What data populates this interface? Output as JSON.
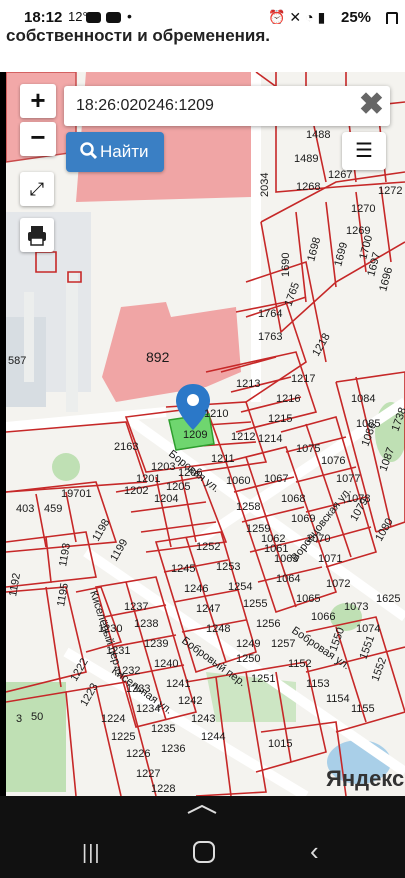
{
  "status_bar": {
    "time": "18:12",
    "temperature": "12°",
    "battery": "25%"
  },
  "page": {
    "heading": "собственности и обременения."
  },
  "map": {
    "search_value": "18:26:020246:1209",
    "find_label": "Найти",
    "zoom_in_label": "+",
    "zoom_out_label": "−",
    "clear_label": "✖",
    "attribution": "Яндекс",
    "selected_parcel": "1209",
    "street_labels": [
      "Боровая ул.",
      "Бобровый пер.",
      "Киселёвый пер.",
      "Кисельная ул.",
      "Бобровая ул.",
      "Воронцовская ул."
    ],
    "parcels": [
      "1488",
      "1489",
      "1267",
      "1268",
      "1269",
      "1270",
      "1272",
      "1700",
      "1699",
      "1698",
      "1697",
      "1696",
      "1690",
      "1765",
      "1764",
      "1763",
      "1218",
      "1217",
      "1216",
      "1215",
      "1214",
      "1213",
      "1210",
      "1212",
      "1211",
      "2163",
      "1209",
      "1201",
      "1202",
      "1203",
      "1204",
      "1205",
      "1206",
      "1075",
      "1076",
      "1077",
      "1078",
      "1079",
      "1080",
      "1084",
      "1085",
      "1086",
      "1087",
      "1738",
      "1067",
      "1068",
      "1069",
      "1070",
      "1071",
      "1072",
      "1073",
      "1074",
      "1258",
      "1259",
      "1060",
      "1061",
      "1062",
      "1063",
      "1064",
      "1065",
      "1066",
      "1245",
      "1246",
      "1247",
      "1248",
      "1249",
      "1250",
      "1251",
      "1252",
      "1253",
      "1254",
      "1255",
      "1256",
      "1257",
      "1230",
      "1231",
      "1232",
      "1233",
      "1234",
      "1235",
      "1236",
      "1237",
      "1238",
      "1239",
      "1240",
      "1241",
      "1242",
      "1243",
      "1244",
      "1222",
      "1223",
      "1224",
      "1225",
      "1226",
      "1227",
      "1228",
      "1198",
      "1199",
      "1193",
      "1195",
      "1192",
      "1152",
      "1153",
      "1154",
      "1155",
      "1550",
      "1551",
      "1552",
      "1625",
      "1015",
      "2034",
      "892",
      "587",
      "19701",
      "403",
      "459",
      "3",
      "50"
    ]
  }
}
